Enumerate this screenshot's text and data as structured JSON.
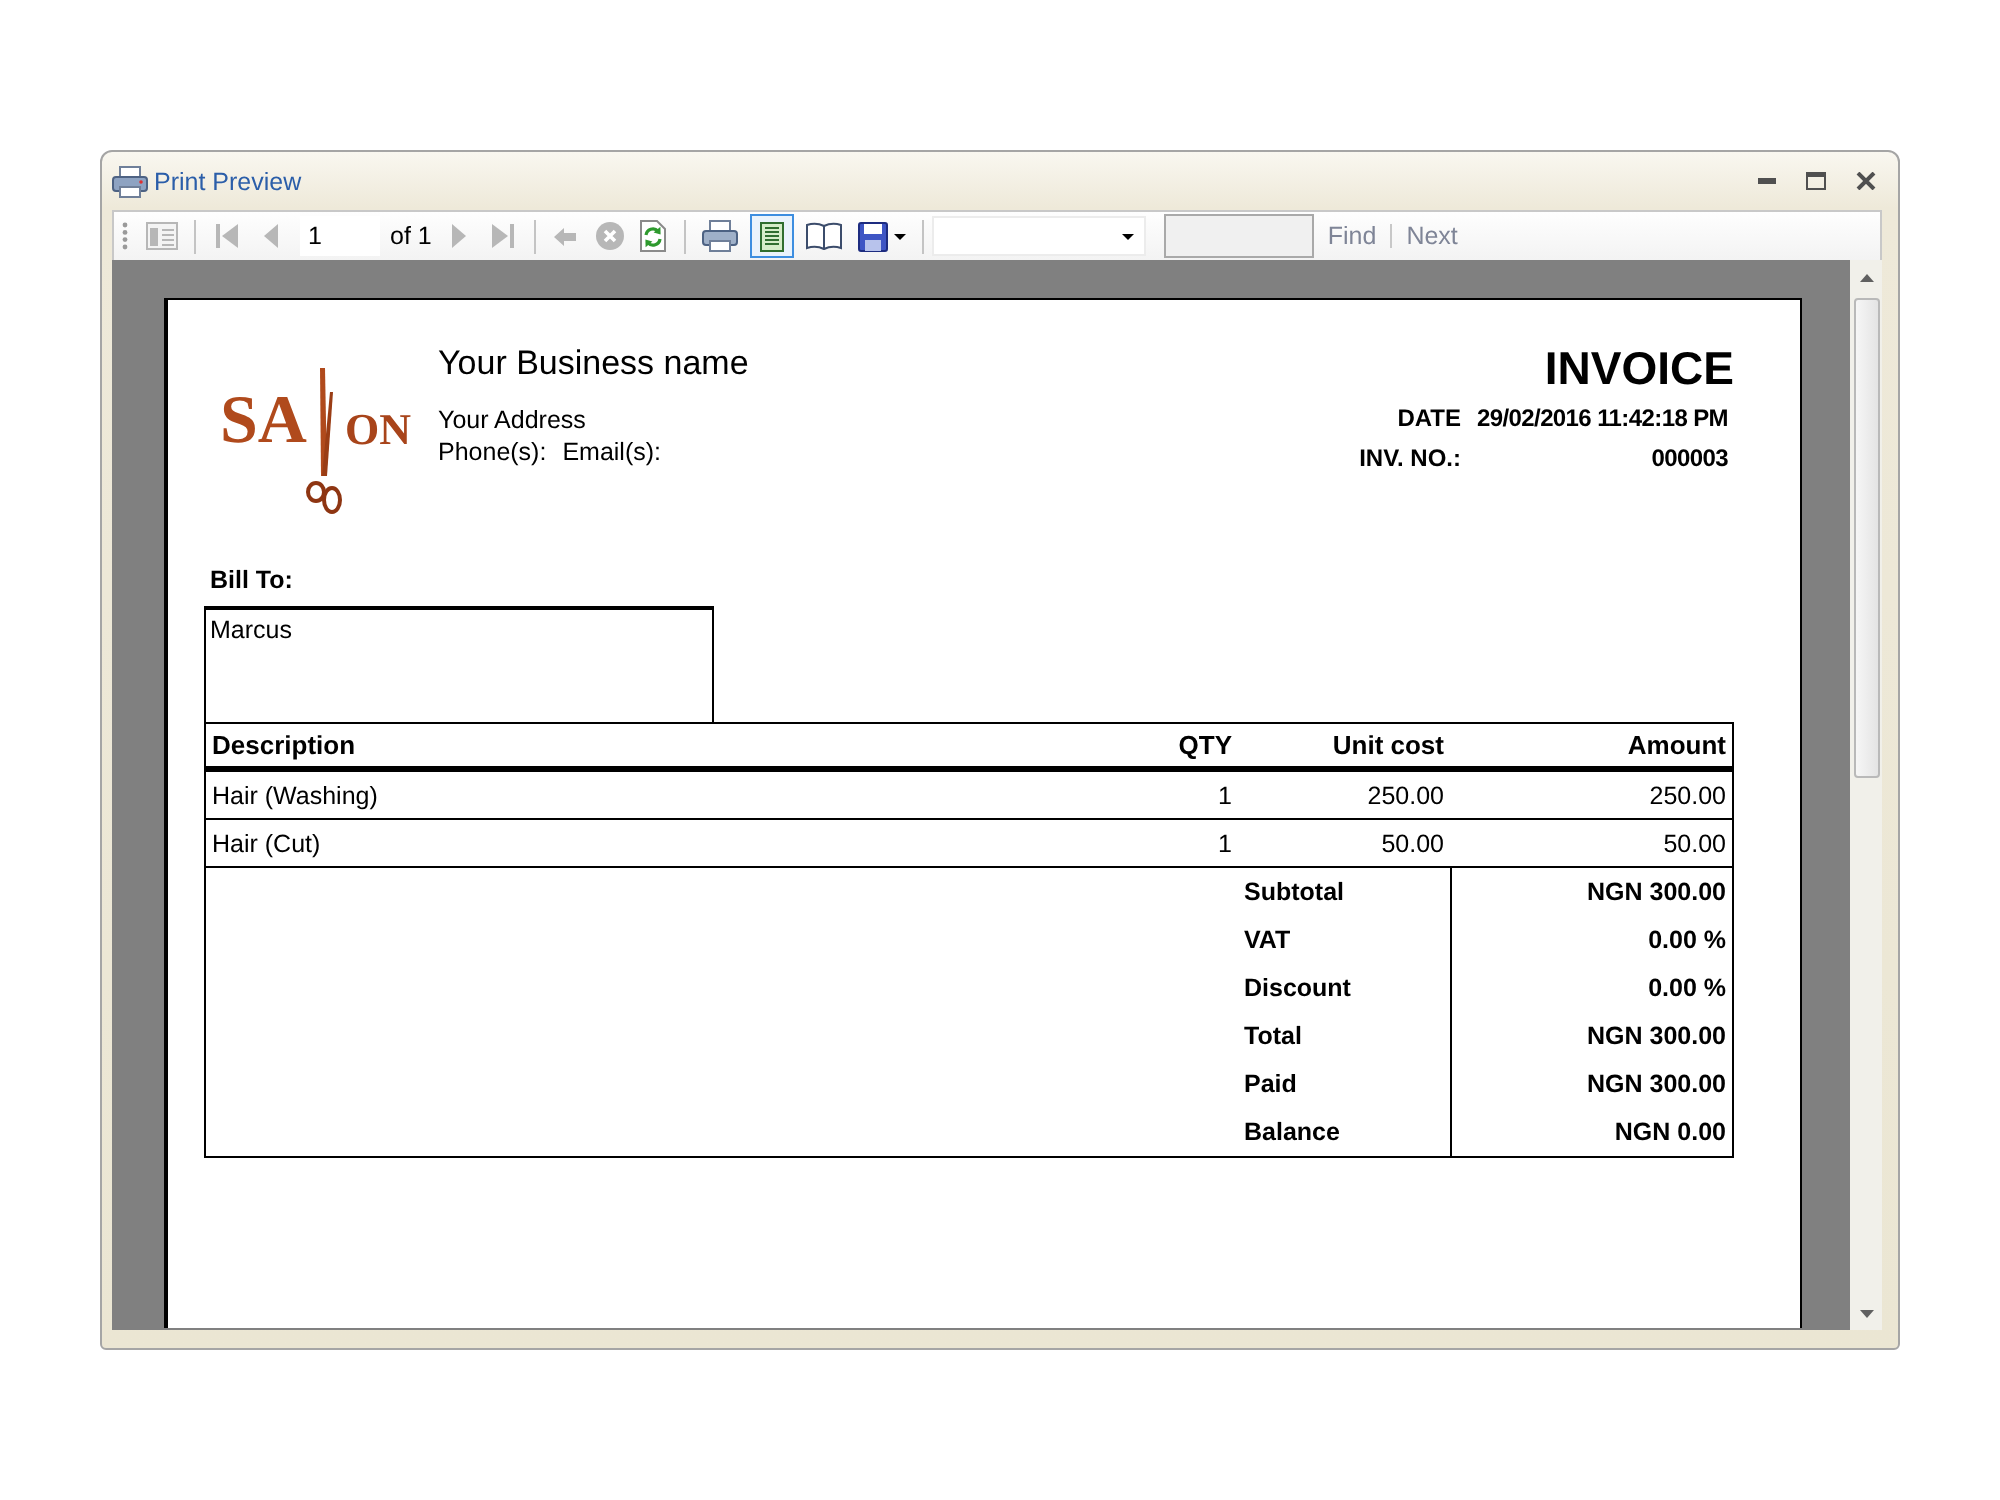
{
  "window": {
    "title": "Print Preview"
  },
  "toolbar": {
    "groups": [
      [
        {
          "kind": "map",
          "disabled": true,
          "on": false
        }
      ],
      [
        {
          "kind": "first",
          "disabled": true,
          "on": false
        },
        {
          "kind": "previous",
          "disabled": true,
          "on": false
        },
        {
          "kind": "page",
          "value": "1"
        },
        {
          "kind": "count",
          "text": "of 1"
        },
        {
          "kind": "next",
          "disabled": true,
          "on": false
        },
        {
          "kind": "last",
          "disabled": true,
          "on": false
        }
      ],
      [
        {
          "kind": "back",
          "disabled": true,
          "on": false
        },
        {
          "kind": "stop",
          "disabled": true,
          "on": false
        },
        {
          "kind": "refresh",
          "disabled": false,
          "on": false
        }
      ],
      [
        {
          "kind": "print",
          "disabled": false,
          "on": false
        },
        {
          "kind": "layout",
          "disabled": false,
          "on": true
        },
        {
          "kind": "setup",
          "disabled": false,
          "on": false
        },
        {
          "kind": "save",
          "disabled": false,
          "on": false
        }
      ],
      [
        {
          "kind": "zoom"
        },
        {
          "kind": "search"
        },
        {
          "kind": "link",
          "text": "Find",
          "disabled": true
        },
        {
          "kind": "link",
          "text": "Next",
          "disabled": true
        }
      ]
    ]
  },
  "document": {
    "logo": {
      "letters": [
        "SA",
        "ON"
      ]
    },
    "business": {
      "name": "Your Business name",
      "address": "Your Address",
      "contacts": [
        "Phone(s):",
        "Email(s):"
      ]
    },
    "title": "INVOICE",
    "meta": [
      {
        "label": "DATE",
        "value": "29/02/2016 11:42:18 PM"
      },
      {
        "label": "INV. NO.:",
        "value": "000003"
      }
    ],
    "bill_to": {
      "label": "Bill To:",
      "name": "Marcus"
    },
    "table": {
      "columns": [
        "Description",
        "QTY",
        "Unit cost",
        "Amount"
      ],
      "rows": [
        [
          "Hair (Washing)",
          "1",
          "250.00",
          "250.00"
        ],
        [
          "Hair (Cut)",
          "1",
          "50.00",
          "50.00"
        ]
      ]
    },
    "totals": [
      {
        "label": "Subtotal",
        "value": "NGN 300.00"
      },
      {
        "label": "VAT",
        "value": "0.00 %"
      },
      {
        "label": "Discount",
        "value": "0.00 %"
      },
      {
        "label": "Total",
        "value": "NGN 300.00"
      },
      {
        "label": "Paid",
        "value": "NGN 300.00"
      },
      {
        "label": "Balance",
        "value": "NGN 0.00"
      }
    ]
  }
}
